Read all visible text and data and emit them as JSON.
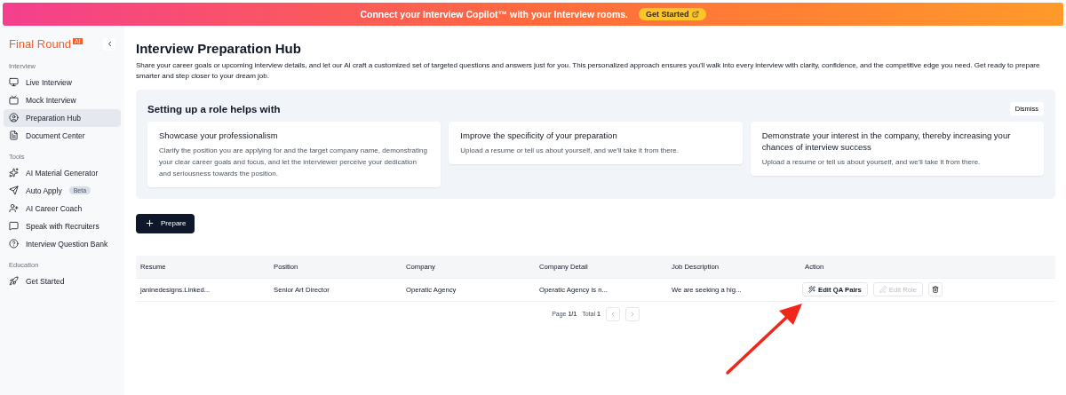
{
  "banner": {
    "text": "Connect your Interview Copilot™ with your Interview rooms.",
    "button": "Get Started"
  },
  "sidebar": {
    "logo": "Final Round",
    "logo_badge": "AI",
    "sections": [
      {
        "title": "Interview",
        "items": [
          {
            "label": "Live Interview",
            "selected": false
          },
          {
            "label": "Mock Interview",
            "selected": false
          },
          {
            "label": "Preparation Hub",
            "selected": true
          },
          {
            "label": "Document Center",
            "selected": false
          }
        ]
      },
      {
        "title": "Tools",
        "items": [
          {
            "label": "AI Material Generator",
            "selected": false
          },
          {
            "label": "Auto Apply",
            "selected": false,
            "badge": "Beta"
          },
          {
            "label": "AI Career Coach",
            "selected": false
          },
          {
            "label": "Speak with Recruiters",
            "selected": false
          },
          {
            "label": "Interview Question Bank",
            "selected": false
          }
        ]
      },
      {
        "title": "Education",
        "items": [
          {
            "label": "Get Started",
            "selected": false
          }
        ]
      }
    ]
  },
  "page": {
    "title": "Interview Preparation Hub",
    "description": "Share your career goals or upcoming interview details, and let our AI craft a customized set of targeted questions and answers just for you. This personalized approach ensures you'll walk into every interview with clarity, confidence, and the competitive edge you need. Get ready to prepare smarter and step closer to your dream job."
  },
  "setup": {
    "title": "Setting up a role helps with",
    "dismiss": "Dismiss",
    "cards": [
      {
        "title": "Showcase your professionalism",
        "text": "Clarify the position you are applying for and the target company name, demonstrating your clear career goals and focus, and let the interviewer perceive your dedication and seriousness towards the position."
      },
      {
        "title": "Improve the specificity of your preparation",
        "text": "Upload a resume or tell us about yourself, and we'll take it from there."
      },
      {
        "title": "Demonstrate your interest in the company, thereby increasing your chances of interview success",
        "text": "Upload a resume or tell us about yourself, and we'll take it from there."
      }
    ]
  },
  "prepare_button": "Prepare",
  "table": {
    "columns": [
      "Resume",
      "Position",
      "Company",
      "Company Detail",
      "Job Description",
      "Action"
    ],
    "rows": [
      {
        "cells": [
          "janinedesigns.Linked...",
          "Senior Art Director",
          "Operatic Agency",
          "Operatic Agency is n...",
          "We are seeking a hig..."
        ],
        "actions": [
          {
            "label": "Edit QA Pairs",
            "disabled": false
          },
          {
            "label": "Edit Role",
            "disabled": true
          }
        ]
      }
    ]
  },
  "pagination": {
    "page": "Page **1/1**",
    "total": "Total **1**"
  }
}
